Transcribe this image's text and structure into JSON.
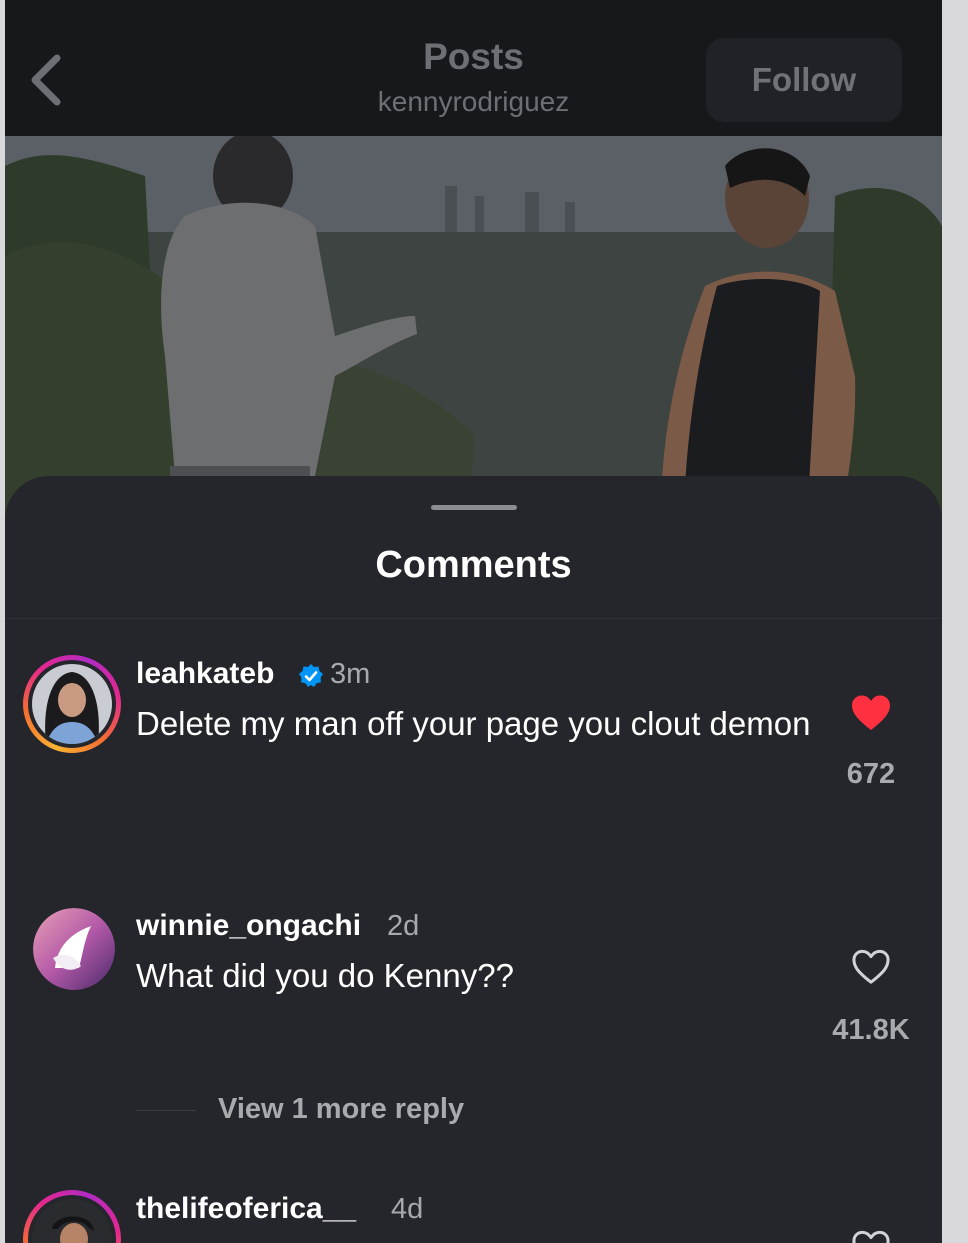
{
  "header": {
    "title": "Posts",
    "subtitle": "kennyrodriguez",
    "follow_label": "Follow"
  },
  "sheet": {
    "title": "Comments"
  },
  "comments": [
    {
      "username": "leahkateb",
      "verified": true,
      "time": "3m",
      "text": "Delete my man off your page you clout demon",
      "liked": true,
      "likes": "672",
      "icon": "heart-filled-icon"
    },
    {
      "username": "winnie_ongachi",
      "verified": false,
      "time": "2d",
      "text": "What did you do Kenny??",
      "liked": false,
      "likes": "41.8K",
      "icon": "heart-outline-icon",
      "view_replies": "View 1 more reply"
    },
    {
      "username": "thelifeoferica__",
      "verified": false,
      "time": "4d",
      "liked": false,
      "icon": "heart-outline-icon"
    }
  ],
  "colors": {
    "background": "#24262b",
    "header": "#16181c",
    "like_red": "#ff3040",
    "verified_blue": "#0095f6"
  }
}
